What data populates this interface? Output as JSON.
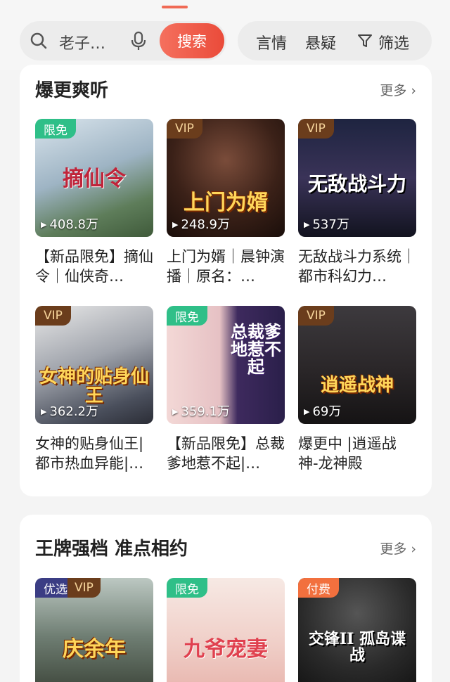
{
  "search": {
    "query": "老子…",
    "button_label": "搜索"
  },
  "filters": {
    "chip1": "言情",
    "chip2": "悬疑",
    "filter_label": "筛选"
  },
  "sections": [
    {
      "title": "爆更爽听",
      "more_label": "更多",
      "cards": [
        {
          "badge": "限免",
          "cover_text": "摘仙令",
          "plays": "408.8万",
          "title": "【新品限免】摘仙令｜仙侠奇…"
        },
        {
          "badge": "VIP",
          "cover_text": "上门为婿",
          "plays": "248.9万",
          "title": "上门为婿｜晨钟演播｜原名：…"
        },
        {
          "badge": "VIP",
          "cover_text": "无敌战斗力",
          "plays": "537万",
          "title": "无敌战斗力系统｜都市科幻力…"
        },
        {
          "badge": "VIP",
          "cover_text": "女神的贴身仙王",
          "plays": "362.2万",
          "title": "女神的贴身仙王|都市热血异能|…"
        },
        {
          "badge": "限免",
          "cover_text": "总裁爹地惹不起",
          "plays": "359.1万",
          "title": "【新品限免】总裁爹地惹不起|…"
        },
        {
          "badge": "VIP",
          "cover_text": "逍遥战神",
          "plays": "69万",
          "title": "爆更中 |逍遥战神-龙神殿"
        }
      ]
    },
    {
      "title": "王牌强档 准点相约",
      "more_label": "更多",
      "cards": [
        {
          "badge": "优选",
          "badge2": "VIP",
          "cover_text": "庆余年"
        },
        {
          "badge": "限免",
          "cover_text": "九爷宠妻"
        },
        {
          "badge": "付费",
          "cover_text": "交锋II 孤岛谍战"
        }
      ]
    }
  ],
  "colors": {
    "accent": "#ea4b3a",
    "free_badge": "#2fbf88",
    "vip_badge": "#6b3d1c",
    "paid_badge": "#f2703e"
  }
}
